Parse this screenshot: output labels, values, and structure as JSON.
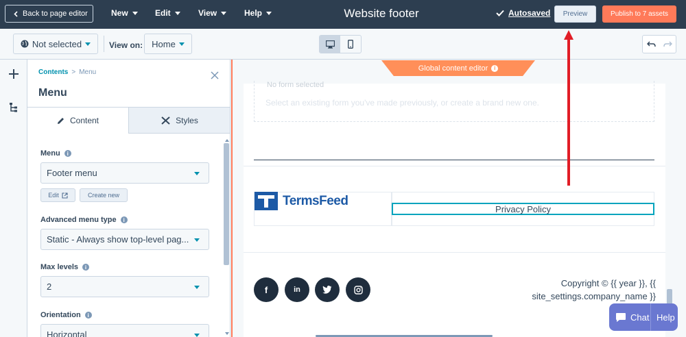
{
  "topbar": {
    "back_label": "Back to page editor",
    "menus": [
      "New",
      "Edit",
      "View",
      "Help"
    ],
    "title": "Website footer",
    "autosaved": "Autosaved",
    "preview": "Preview",
    "publish": "Publish to 7 assets"
  },
  "toolbar": {
    "language_select": "Not selected",
    "view_on_label": "View on:",
    "view_on_value": "Home"
  },
  "panel": {
    "breadcrumb_root": "Contents",
    "breadcrumb_sep": ">",
    "breadcrumb_current": "Menu",
    "title": "Menu",
    "tabs": [
      {
        "label": "Content",
        "active": true
      },
      {
        "label": "Styles",
        "active": false
      }
    ],
    "fields": {
      "menu_label": "Menu",
      "menu_value": "Footer menu",
      "edit_label": "Edit",
      "create_new_label": "Create new",
      "advanced_label": "Advanced menu type",
      "advanced_value": "Static - Always show top-level pag...",
      "max_levels_label": "Max levels",
      "max_levels_value": "2",
      "orientation_label": "Orientation",
      "orientation_value": "Horizontal"
    }
  },
  "canvas": {
    "global_editor_label": "Global content editor",
    "form_ghost_title": "No form selected",
    "form_ghost_text": "Select an existing form you've made previously, or create a brand new one.",
    "logo_text": "TermsFeed",
    "menu_item": "Privacy Policy",
    "social": [
      "f",
      "in",
      "t",
      "ig"
    ],
    "copyright_line1": "Copyright © {{ year }}, {{",
    "copyright_line2": "site_settings.company_name }}"
  },
  "chat": {
    "chat_label": "Chat",
    "help_label": "Help"
  },
  "colors": {
    "topbar_bg": "#2d3e50",
    "accent_orange": "#ff7a59",
    "teal": "#0091ae",
    "annotation_red": "#e11d26",
    "chat_purple": "#6a78d1"
  }
}
